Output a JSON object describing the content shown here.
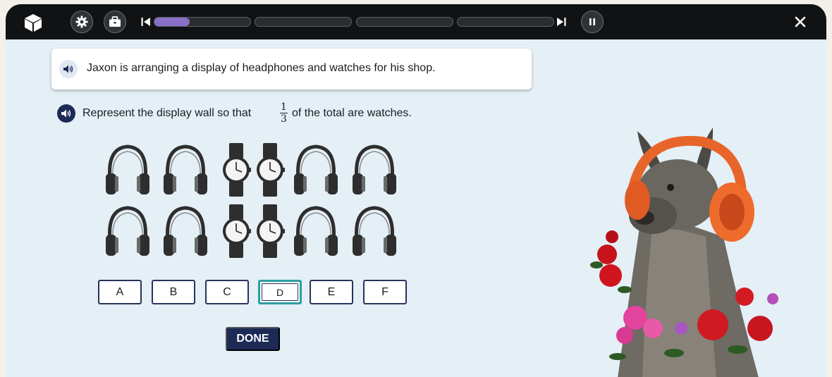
{
  "toolbar": {
    "logo_icon": "cube-logo-icon",
    "settings_icon": "gear-icon",
    "toolbox_icon": "briefcase-icon",
    "prev_icon": "skip-back-icon",
    "next_icon": "skip-forward-icon",
    "pause_icon": "pause-icon",
    "close_icon": "close-icon",
    "progress_segments": [
      {
        "fill": 0.37
      },
      {
        "fill": 0
      },
      {
        "fill": 0
      },
      {
        "fill": 0
      }
    ],
    "progress_color": "#8a6fc7"
  },
  "prompt": {
    "text": "Jaxon is arranging a display of headphones and watches for his shop."
  },
  "question": {
    "before": "Represent the display wall so that",
    "numerator": "1",
    "denominator": "3",
    "after": "of the total are watches."
  },
  "display": {
    "rows": [
      [
        "headphones",
        "headphones",
        "watch",
        "watch",
        "headphones",
        "headphones"
      ],
      [
        "headphones",
        "headphones",
        "watch",
        "watch",
        "headphones",
        "headphones"
      ]
    ]
  },
  "choices": [
    {
      "label": "A",
      "selected": false
    },
    {
      "label": "B",
      "selected": false
    },
    {
      "label": "C",
      "selected": false
    },
    {
      "label": "D",
      "selected": true
    },
    {
      "label": "E",
      "selected": false
    },
    {
      "label": "F",
      "selected": false
    }
  ],
  "done_label": "DONE",
  "colors": {
    "accent_navy": "#1c2a55",
    "selected_outline": "#2b9ea4",
    "background": "#e4eff6"
  }
}
